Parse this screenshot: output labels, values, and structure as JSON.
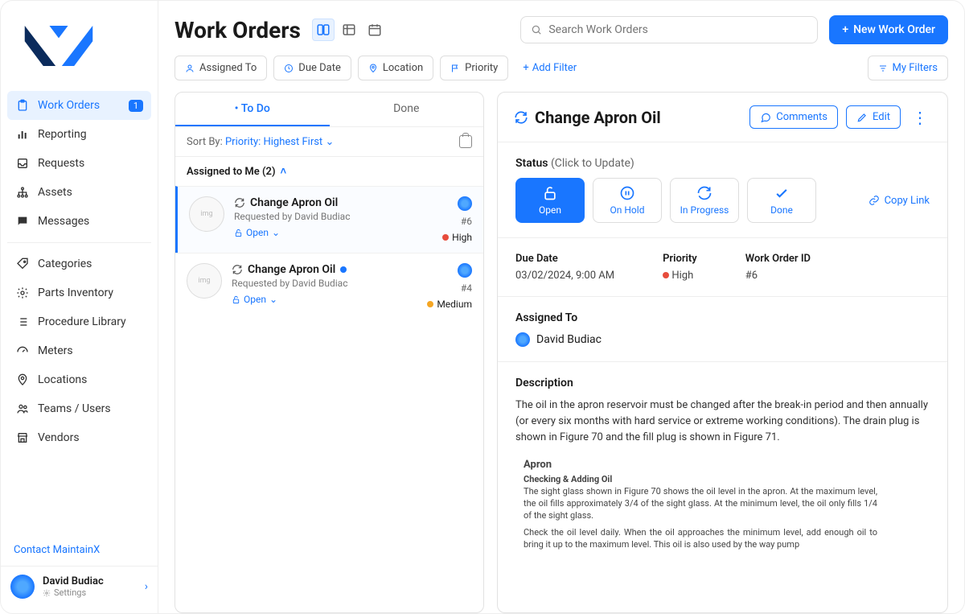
{
  "page": {
    "title": "Work Orders"
  },
  "search": {
    "placeholder": "Search Work Orders"
  },
  "header": {
    "new_button": "New Work Order"
  },
  "filters": {
    "assigned_to": "Assigned To",
    "due_date": "Due Date",
    "location": "Location",
    "priority": "Priority",
    "add_filter": "Add Filter",
    "my_filters": "My Filters"
  },
  "sidebar": {
    "items": [
      {
        "label": "Work Orders",
        "badge": "1"
      },
      {
        "label": "Reporting"
      },
      {
        "label": "Requests"
      },
      {
        "label": "Assets"
      },
      {
        "label": "Messages"
      }
    ],
    "secondary": [
      {
        "label": "Categories"
      },
      {
        "label": "Parts Inventory"
      },
      {
        "label": "Procedure Library"
      },
      {
        "label": "Meters"
      },
      {
        "label": "Locations"
      },
      {
        "label": "Teams / Users"
      },
      {
        "label": "Vendors"
      }
    ],
    "contact": "Contact MaintainX",
    "user": {
      "name": "David Budiac",
      "sub": "Settings"
    }
  },
  "list": {
    "tabs": {
      "todo": "To Do",
      "done": "Done"
    },
    "sort": {
      "label": "Sort By:",
      "field": "Priority",
      "dir": "Highest First"
    },
    "group": "Assigned to Me (2)",
    "cards": [
      {
        "title": "Change Apron Oil",
        "requested": "Requested by David Budiac",
        "status": "Open",
        "id": "#6",
        "priority": "High"
      },
      {
        "title": "Change Apron Oil",
        "requested": "Requested by David Budiac",
        "status": "Open",
        "id": "#4",
        "priority": "Medium"
      }
    ]
  },
  "detail": {
    "title": "Change Apron Oil",
    "buttons": {
      "comments": "Comments",
      "edit": "Edit"
    },
    "status_label": "Status",
    "status_hint": "(Click to Update)",
    "statuses": {
      "open": "Open",
      "on_hold": "On Hold",
      "in_progress": "In Progress",
      "done": "Done"
    },
    "copy_link": "Copy Link",
    "meta": {
      "due_date_label": "Due Date",
      "due_date": "03/02/2024, 9:00 AM",
      "priority_label": "Priority",
      "priority": "High",
      "id_label": "Work Order ID",
      "id": "#6"
    },
    "assigned_label": "Assigned To",
    "assigned_to": "David Budiac",
    "desc_label": "Description",
    "description": "The oil in the apron reservoir must be changed after the break-in period and then annually (or every six months with hard service or extreme working conditions). The drain plug is shown in Figure 70 and the fill plug is shown in Figure 71.",
    "doc": {
      "h1": "Apron",
      "h2": "Checking & Adding Oil",
      "p1": "The sight glass shown in Figure 70 shows the oil level in the apron. At the maximum level, the oil fills approximately 3/4 of the sight glass. At the minimum level, the oil only fills 1/4 of the sight glass.",
      "p2": "Check the oil level daily. When the oil approaches the minimum level, add enough oil to bring it up to the maximum level. This oil is also used by the way pump"
    }
  }
}
